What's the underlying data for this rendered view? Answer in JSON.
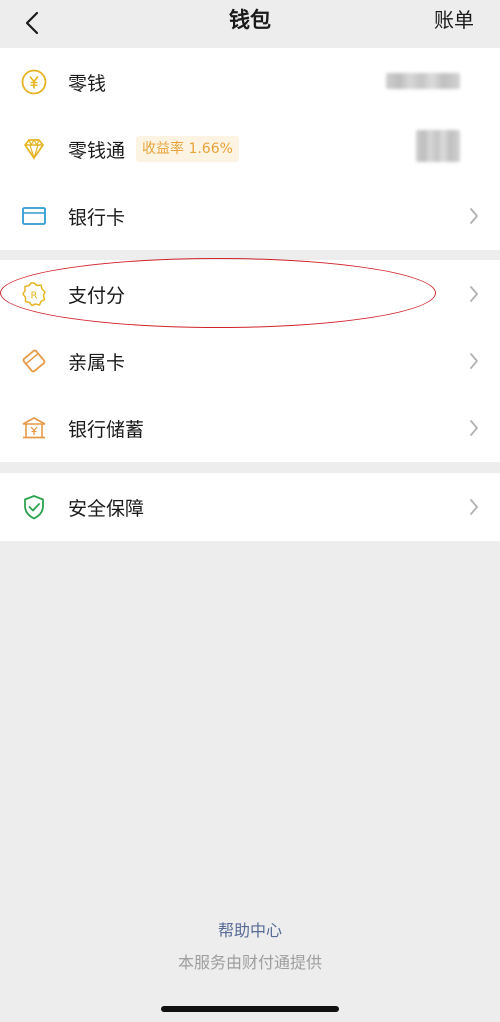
{
  "header": {
    "title": "钱包",
    "bill_label": "账单"
  },
  "groups": [
    {
      "items": [
        {
          "label": "零钱",
          "icon": "coin-yen-icon",
          "value_hidden": true
        },
        {
          "label": "零钱通",
          "icon": "diamond-icon",
          "badge": "收益率 1.66%",
          "value_hidden": true
        },
        {
          "label": "银行卡",
          "icon": "bank-card-icon"
        }
      ]
    },
    {
      "items": [
        {
          "label": "支付分",
          "icon": "payscore-badge-icon",
          "highlighted": true
        },
        {
          "label": "亲属卡",
          "icon": "family-card-icon"
        },
        {
          "label": "银行储蓄",
          "icon": "bank-savings-icon"
        }
      ]
    },
    {
      "items": [
        {
          "label": "安全保障",
          "icon": "security-shield-icon"
        }
      ]
    }
  ],
  "footer": {
    "help_link": "帮助中心",
    "provider_text": "本服务由财付通提供"
  },
  "colors": {
    "background": "#ededed",
    "card": "#ffffff",
    "icon_gold": "#e6b422",
    "icon_blue": "#2f9bd1",
    "icon_orange": "#e59a48",
    "icon_green": "#2ea44f",
    "badge_text": "#e8a33a",
    "link": "#576b95",
    "annotation_red": "#d0242b"
  }
}
